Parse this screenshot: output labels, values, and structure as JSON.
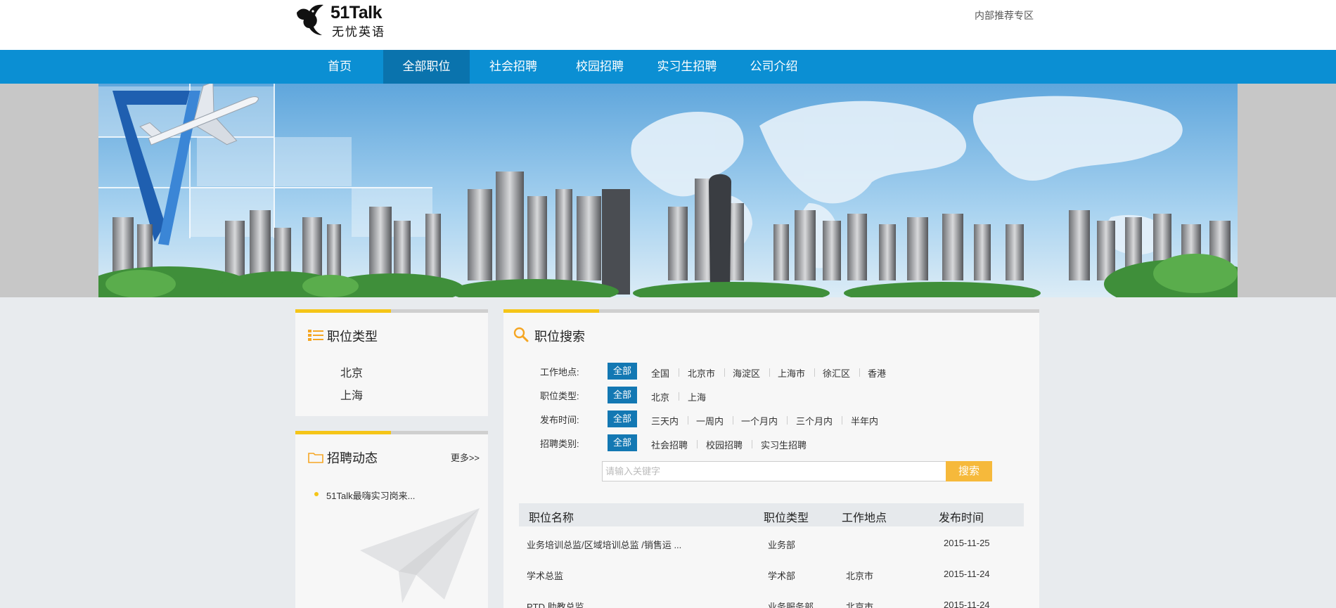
{
  "header": {
    "logo_name": "51Talk",
    "logo_sub": "无忧英语",
    "top_link": "内部推荐专区"
  },
  "nav": {
    "items": [
      {
        "label": "首页"
      },
      {
        "label": "全部职位"
      },
      {
        "label": "社会招聘"
      },
      {
        "label": "校园招聘"
      },
      {
        "label": "实习生招聘"
      },
      {
        "label": "公司介绍"
      }
    ],
    "active_index": 1
  },
  "job_types": {
    "title": "职位类型",
    "items": [
      "北京",
      "上海"
    ]
  },
  "news": {
    "title": "招聘动态",
    "more": "更多>>",
    "items": [
      "51Talk最嗨实习岗来..."
    ]
  },
  "search": {
    "title": "职位搜索",
    "filters": [
      {
        "label": "工作地点:",
        "options": [
          "全部",
          "全国",
          "北京市",
          "海淀区",
          "上海市",
          "徐汇区",
          "香港"
        ]
      },
      {
        "label": "职位类型:",
        "options": [
          "全部",
          "北京",
          "上海"
        ]
      },
      {
        "label": "发布时间:",
        "options": [
          "全部",
          "三天内",
          "一周内",
          "一个月内",
          "三个月内",
          "半年内"
        ]
      },
      {
        "label": "招聘类别:",
        "options": [
          "全部",
          "社会招聘",
          "校园招聘",
          "实习生招聘"
        ]
      }
    ],
    "placeholder": "请输入关键字",
    "button": "搜索"
  },
  "table": {
    "headers": [
      "职位名称",
      "职位类型",
      "工作地点",
      "发布时间"
    ],
    "rows": [
      [
        "业务培训总监/区域培训总监 /销售运 ...",
        "业务部",
        "",
        "2015-11-25"
      ],
      [
        "学术总监",
        "学术部",
        "北京市",
        "2015-11-24"
      ],
      [
        "PTD 助教总监",
        "业务服务部",
        "北京市",
        "2015-11-24"
      ]
    ]
  },
  "colors": {
    "nav_bg": "#0b8fd3",
    "nav_active": "#0a73ad",
    "accent_yellow": "#f5c518",
    "selected_blue": "#1378b3",
    "search_button": "#f6b93b"
  }
}
